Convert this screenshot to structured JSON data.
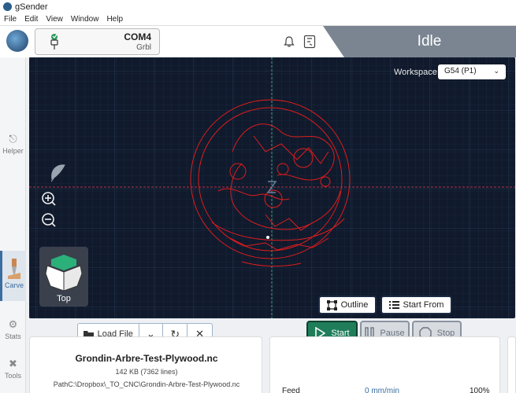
{
  "app": {
    "title": "gSender"
  },
  "menu": [
    "File",
    "Edit",
    "View",
    "Window",
    "Help"
  ],
  "connection": {
    "port": "COM4",
    "firmware": "Grbl"
  },
  "machine_state": "Idle",
  "nav": {
    "helper": "Helper",
    "carve": "Carve",
    "stats": "Stats",
    "tools": "Tools"
  },
  "visualizer": {
    "workspace_label": "Workspace:",
    "workspace_value": "G54 (P1)",
    "camera_view": "Top",
    "outline_label": "Outline",
    "start_from_label": "Start From"
  },
  "file_toolbar": {
    "load_label": "Load File"
  },
  "run_controls": {
    "start": "Start",
    "pause": "Pause",
    "stop": "Stop"
  },
  "file_info": {
    "name": "Grondin-Arbre-Test-Plywood.nc",
    "size": "142 KB (7362 lines)",
    "path": "PathC:\\Dropbox\\_TO_CNC\\Grondin-Arbre-Test-Plywood.nc"
  },
  "overrides": {
    "feed_label": "Feed",
    "feed_value": "0 mm/min",
    "feed_percent": "100%"
  },
  "colors": {
    "accent": "#3b6da0",
    "start": "#1f7d5a",
    "toolpath": "#e01c1c",
    "viz_bg": "#101a2c"
  }
}
